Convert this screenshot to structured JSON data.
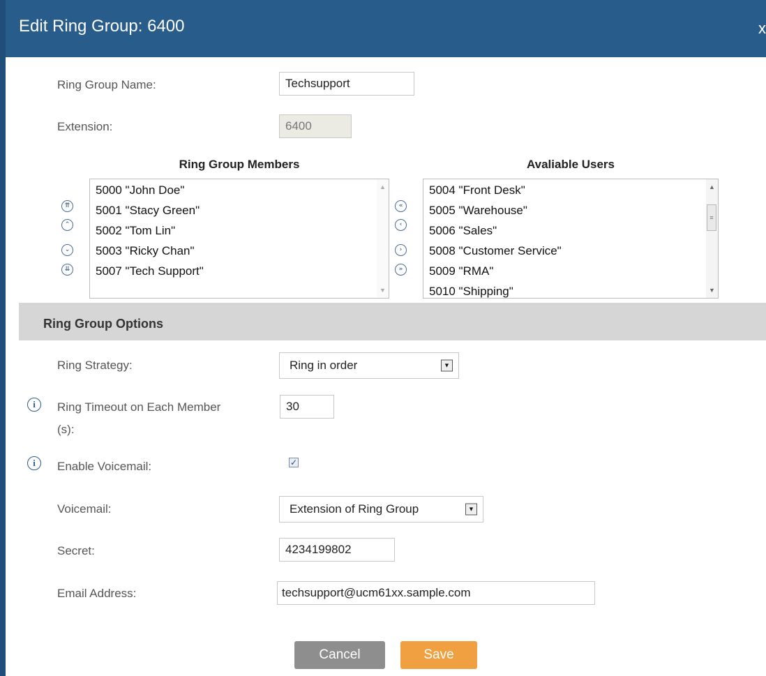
{
  "dialog": {
    "title": "Edit Ring Group: 6400",
    "close_label": "x"
  },
  "form": {
    "ring_group_name_label": "Ring Group Name:",
    "ring_group_name_value": "Techsupport",
    "extension_label": "Extension:",
    "extension_value": "6400"
  },
  "members": {
    "header": "Ring Group Members",
    "items": [
      "5000 \"John Doe\"",
      "5001 \"Stacy Green\"",
      "5002 \"Tom Lin\"",
      "5003 \"Ricky Chan\"",
      "5007 \"Tech Support\""
    ]
  },
  "available": {
    "header": "Avaliable Users",
    "items": [
      "5004 \"Front Desk\"",
      "5005 \"Warehouse\"",
      "5006 \"Sales\"",
      "5008 \"Customer Service\"",
      "5009 \"RMA\"",
      "5010 \"Shipping\""
    ]
  },
  "icons": {
    "order": [
      "move-top-icon",
      "move-up-icon",
      "move-down-icon",
      "move-bottom-icon"
    ],
    "transfer": [
      "add-all-icon",
      "add-selected-icon",
      "remove-selected-icon",
      "remove-all-icon"
    ]
  },
  "options": {
    "section_title": "Ring Group Options",
    "ring_strategy_label": "Ring Strategy:",
    "ring_strategy_value": "Ring in order",
    "ring_timeout_label_line1": "Ring Timeout on Each Member",
    "ring_timeout_label_line2": "(s):",
    "ring_timeout_value": "30",
    "enable_voicemail_label": "Enable Voicemail:",
    "enable_voicemail_checked": true,
    "voicemail_label": "Voicemail:",
    "voicemail_value": "Extension of Ring Group",
    "secret_label": "Secret:",
    "secret_value": "4234199802",
    "email_label": "Email Address:",
    "email_value": "techsupport@ucm61xx.sample.com"
  },
  "buttons": {
    "cancel": "Cancel",
    "save": "Save"
  },
  "colors": {
    "titlebar": "#285c8a",
    "cancel": "#8e8e8e",
    "save": "#f0a040",
    "section": "#d6d6d6"
  }
}
